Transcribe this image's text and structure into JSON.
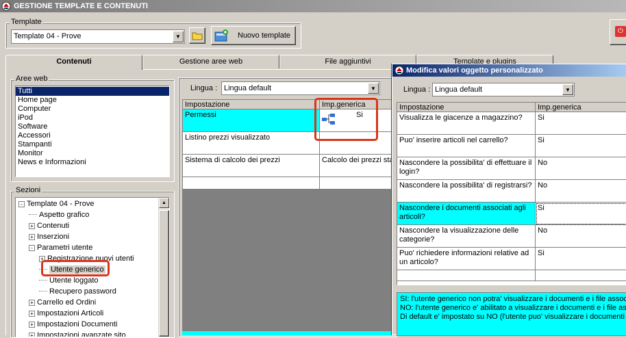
{
  "window": {
    "title": "GESTIONE TEMPLATE E CONTENUTI"
  },
  "template_group": {
    "label": "Template",
    "selected": "Template 04 - Prove",
    "new_button_label": "Nuovo template"
  },
  "tabs": [
    {
      "label": "Contenuti"
    },
    {
      "label": "Gestione aree web"
    },
    {
      "label": "File aggiuntivi"
    },
    {
      "label": "Template e plugins"
    }
  ],
  "aree_web": {
    "label": "Aree web",
    "items": [
      "Tutti",
      "Home page",
      "Computer",
      "iPod",
      "Software",
      "Accessori",
      "Stampanti",
      "Monitor",
      "News e Informazioni"
    ]
  },
  "sezioni": {
    "label": "Sezioni",
    "tree": [
      {
        "text": "Template 04 - Prove",
        "level": 0,
        "sign": "-"
      },
      {
        "text": "Aspetto grafico",
        "level": 1,
        "sign": ""
      },
      {
        "text": "Contenuti",
        "level": 1,
        "sign": "+"
      },
      {
        "text": "Inserzioni",
        "level": 1,
        "sign": "+"
      },
      {
        "text": "Parametri utente",
        "level": 1,
        "sign": "-"
      },
      {
        "text": "Registrazione nuovi utenti",
        "level": 2,
        "sign": "+"
      },
      {
        "text": "Utente generico",
        "level": 2,
        "sign": ""
      },
      {
        "text": "Utente loggato",
        "level": 2,
        "sign": ""
      },
      {
        "text": "Recupero password",
        "level": 2,
        "sign": ""
      },
      {
        "text": "Carrello ed Ordini",
        "level": 1,
        "sign": "+"
      },
      {
        "text": "Impostazioni Articoli",
        "level": 1,
        "sign": "+"
      },
      {
        "text": "Impostazioni Documenti",
        "level": 1,
        "sign": "+"
      },
      {
        "text": "Impostazioni avanzate sito",
        "level": 1,
        "sign": "+"
      }
    ]
  },
  "main_panel": {
    "lingua_label": "Lingua :",
    "lingua_value": "Lingua default",
    "col_impostazione": "Impostazione",
    "col_impgenerica": "Imp.generica",
    "rows": [
      {
        "name": "Permessi",
        "value": "Si"
      },
      {
        "name": "Listino prezzi visualizzato",
        "value": ""
      },
      {
        "name": "Sistema di calcolo dei prezzi",
        "value": "Calcolo dei prezzi sta"
      }
    ]
  },
  "dialog": {
    "title": "Modifica valori oggetto personalizzato",
    "lingua_label": "Lingua :",
    "lingua_value": "Lingua default",
    "col_impostazione": "Impostazione",
    "col_impgenerica": "Imp.generica",
    "rows": [
      {
        "name": "Visualizza le giacenze a magazzino?",
        "value": "Si"
      },
      {
        "name": "Puo' inserire articoli nel carrello?",
        "value": "Si"
      },
      {
        "name": "Nascondere la possibilita' di effettuare il login?",
        "value": "No"
      },
      {
        "name": "Nascondere la possibilita' di registrarsi?",
        "value": "No"
      },
      {
        "name": "Nascondere i documenti associati agli articoli?",
        "value": "Si"
      },
      {
        "name": "Nascondere la visualizzazione delle categorie?",
        "value": "No"
      },
      {
        "name": "Puo' richiedere informazioni relative ad un articolo?",
        "value": "Si"
      }
    ],
    "info_lines": [
      "SI: l'utente generico non potra' visualizzare i documenti e i file associ",
      "NO: l'utente generico e' abilitato a visualizzare i documenti e i file asso",
      "Di default e' impostato su NO (l'utente puo' visualizzare i documenti e i"
    ]
  },
  "colors": {
    "highlight": "#00ffff",
    "selection": "#0a246a",
    "annotation": "#d9341a"
  }
}
